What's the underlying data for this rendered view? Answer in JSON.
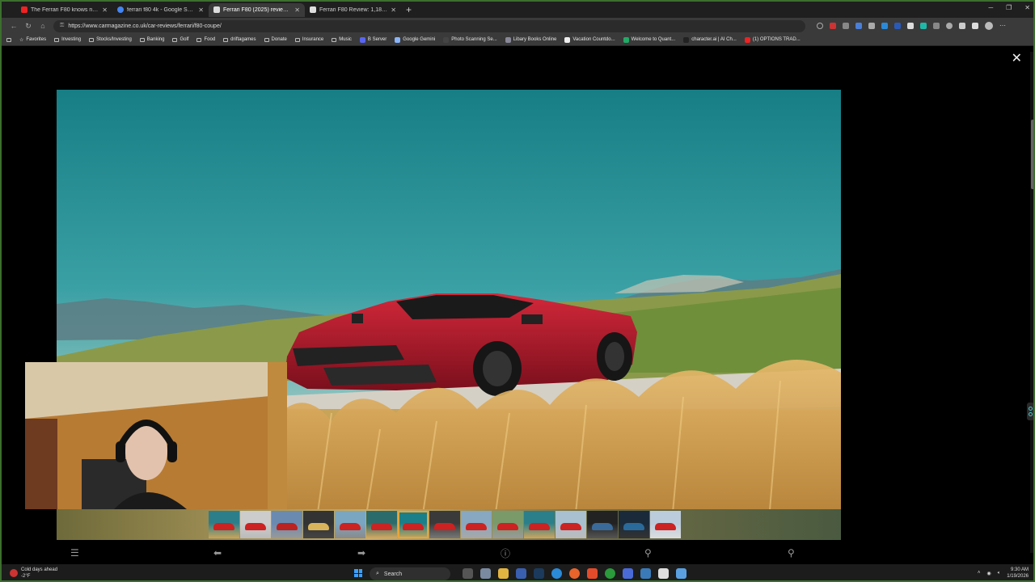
{
  "browser": {
    "tabs": [
      {
        "title": "The Ferrari F80 knows no limits - Y",
        "color": "#e22"
      },
      {
        "title": "ferrari f80 4k - Google Search",
        "color": "#4285f4"
      },
      {
        "title": "Ferrari F80 (2025) review: ferocio",
        "color": "#ddd"
      },
      {
        "title": "Ferrari F80 Review: 1,183HP Hybri",
        "color": "#ddd"
      }
    ],
    "url": "https://www.carmagazine.co.uk/car-reviews/ferrari/f80-coupe/",
    "bookmarks": [
      {
        "label": "Favorites",
        "kind": "star"
      },
      {
        "label": "Investing",
        "kind": "folder"
      },
      {
        "label": "Stocks/Investing",
        "kind": "folder"
      },
      {
        "label": "Banking",
        "kind": "folder"
      },
      {
        "label": "Golf",
        "kind": "folder"
      },
      {
        "label": "Food",
        "kind": "folder"
      },
      {
        "label": "driftagames",
        "kind": "folder"
      },
      {
        "label": "Donate",
        "kind": "folder"
      },
      {
        "label": "Insurance",
        "kind": "folder"
      },
      {
        "label": "Music",
        "kind": "folder"
      },
      {
        "label": "B Server",
        "kind": "icon",
        "color": "#5865f2"
      },
      {
        "label": "Google Gemini",
        "kind": "icon",
        "color": "#8ab4f8"
      },
      {
        "label": "Photo Scanning Se...",
        "kind": "icon",
        "color": "#444"
      },
      {
        "label": "Libary Books Online",
        "kind": "icon",
        "color": "#889"
      },
      {
        "label": "Vacation Countdo...",
        "kind": "icon",
        "color": "#eee"
      },
      {
        "label": "Welcome to Quant...",
        "kind": "icon",
        "color": "#2a6"
      },
      {
        "label": "character.ai | AI Ch...",
        "kind": "icon",
        "color": "#222"
      },
      {
        "label": "(1) OPTIONS TRAD...",
        "kind": "icon",
        "color": "#e22"
      }
    ]
  },
  "viewer": {
    "close_icon": "close-icon",
    "toolbar_icons": [
      "list-icon",
      "previous-arrow-icon",
      "next-arrow-icon",
      "info-icon",
      "zoom-in-icon",
      "zoom-out-icon"
    ],
    "thumbnail_count": 15,
    "selected_thumbnail_index": 6
  },
  "taskbar": {
    "weather_title": "Cold days ahead",
    "weather_temp": "-2°F",
    "search_label": "Search",
    "time": "9:30 AM",
    "date": "1/19/2026"
  }
}
